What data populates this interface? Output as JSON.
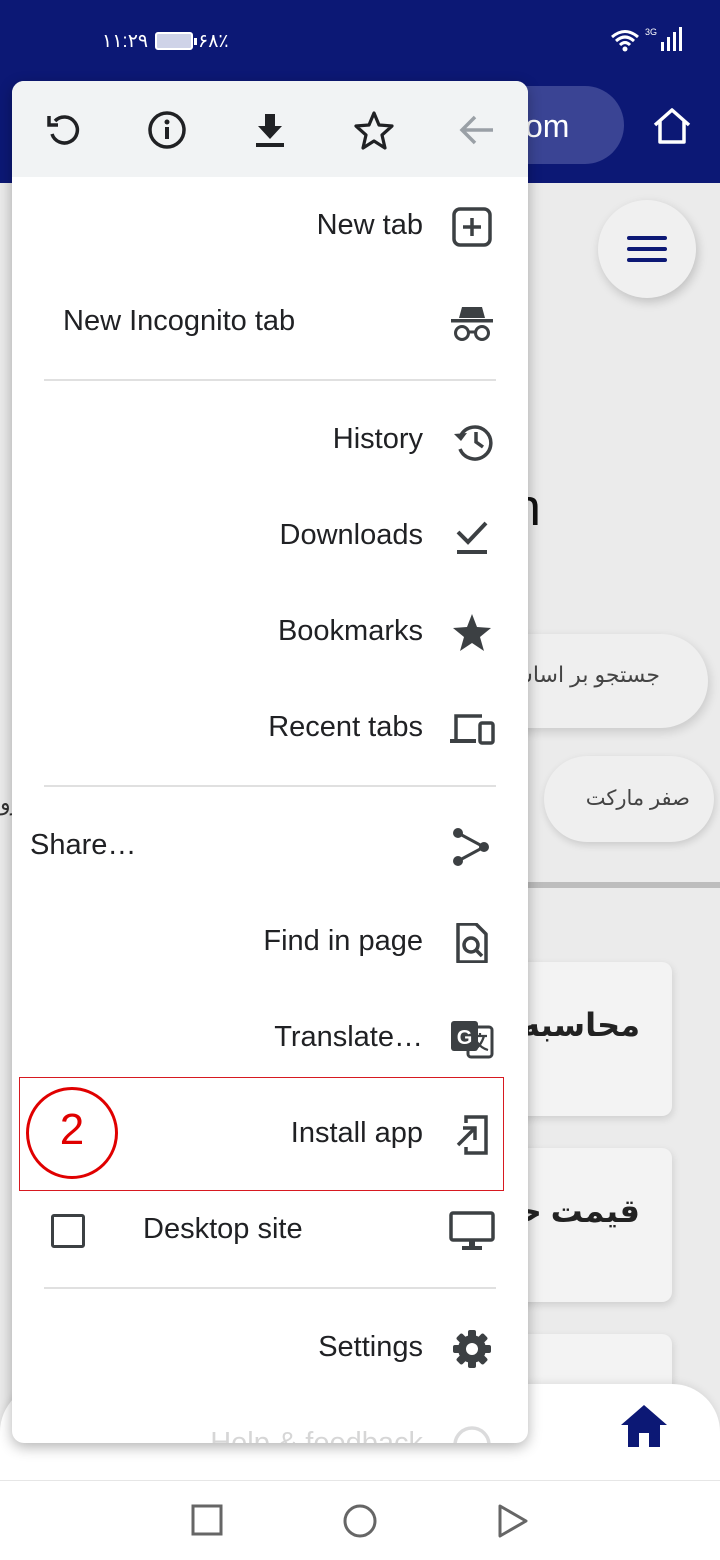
{
  "status_bar": {
    "time": "۱۱:۲۹",
    "battery": "۶۸٪",
    "network": "3G"
  },
  "browser": {
    "url_fragment": "om",
    "home_icon": "home-icon"
  },
  "page": {
    "background_glyph": "n",
    "search_placeholder": "جستجو بر اساس",
    "chip_label": "صفر مارکت",
    "chip_left_partial": "رو",
    "card_1_title": "محاسبه",
    "card_2_title": "قیمت حر"
  },
  "menu": {
    "toolbar_icons": [
      "reload-icon",
      "info-icon",
      "download-icon",
      "bookmark-star-icon",
      "back-arrow-icon"
    ],
    "items": [
      {
        "label": "New tab",
        "icon": "new-tab-icon"
      },
      {
        "label": "New Incognito tab",
        "icon": "incognito-icon"
      },
      {
        "label": "History",
        "icon": "history-icon"
      },
      {
        "label": "Downloads",
        "icon": "downloads-check-icon"
      },
      {
        "label": "Bookmarks",
        "icon": "star-icon"
      },
      {
        "label": "Recent tabs",
        "icon": "devices-icon"
      },
      {
        "label": "Share…",
        "icon": "share-icon"
      },
      {
        "label": "Find in page",
        "icon": "find-in-page-icon"
      },
      {
        "label": "Translate…",
        "icon": "translate-icon"
      },
      {
        "label": "Install app",
        "icon": "install-app-icon"
      },
      {
        "label": "Desktop site",
        "icon": "desktop-icon",
        "checked": false
      },
      {
        "label": "Settings",
        "icon": "gear-icon"
      },
      {
        "label": "Help & feedback",
        "icon": "help-icon"
      }
    ]
  },
  "annotation": {
    "step_number": "2",
    "color": "#e00000"
  },
  "colors": {
    "header": "#0c1875",
    "menu_toolbar": "#f1f3f4",
    "bottom_home": "#0c1875"
  }
}
